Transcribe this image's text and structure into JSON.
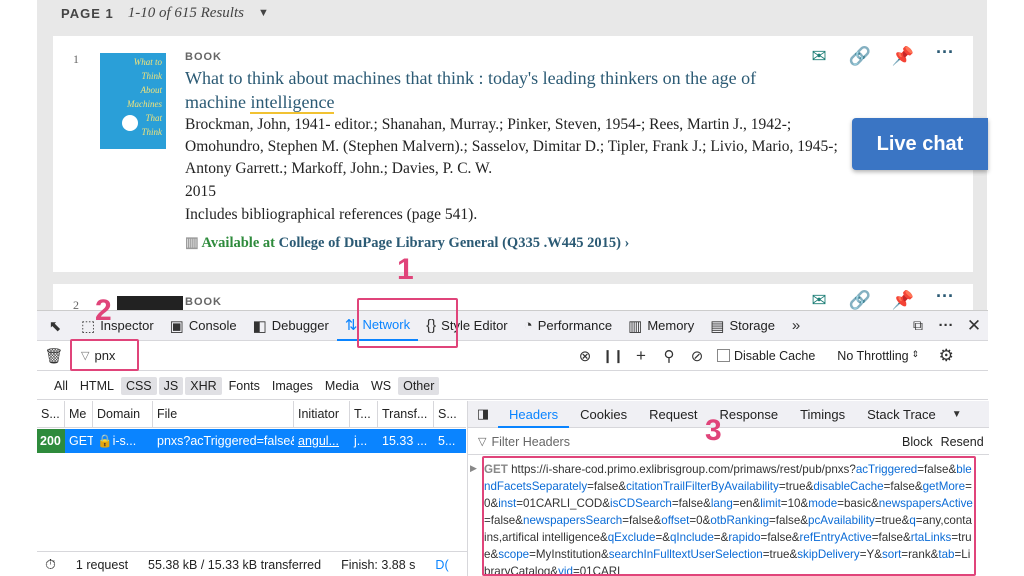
{
  "results": {
    "page_label": "PAGE 1",
    "count_label": "1-10 of 615 Results",
    "items": [
      {
        "number": "1",
        "type": "BOOK",
        "title_main": "What to think about machines that think : today's leading thinkers on the age of machine ",
        "title_highlight": "intelligence",
        "authors": "Brockman, John, 1941- editor.; Shanahan, Murray.; Pinker, Steven, 1954-; Rees, Martin J., 1942-; Omohundro, Stephen M. (Stephen Malvern).; Sasselov, Dimitar D.; Tipler, Frank J.; Livio, Mario, 1945-; Antony Garrett.; Markoff, John.; Davies, P. C. W.",
        "year": "2015",
        "note": "Includes bibliographical references (page 541).",
        "avail_label": "Available at",
        "avail_location": "College of DuPage Library  General (Q335 .W445 2015)",
        "cover_text": [
          "What to",
          "Think",
          "About",
          "Machines",
          "That",
          "Think"
        ]
      },
      {
        "number": "2",
        "type": "BOOK"
      }
    ]
  },
  "live_chat": "Live chat",
  "devtools": {
    "tabs": [
      {
        "icon": "inspector-icon",
        "glyph": "⬚",
        "label": "Inspector"
      },
      {
        "icon": "console-icon",
        "glyph": "▣",
        "label": "Console"
      },
      {
        "icon": "debugger-icon",
        "glyph": "◧",
        "label": "Debugger"
      },
      {
        "icon": "network-icon",
        "glyph": "⇅",
        "label": "Network"
      },
      {
        "icon": "style-editor-icon",
        "glyph": "{}",
        "label": "Style Editor"
      },
      {
        "icon": "performance-icon",
        "glyph": "◔",
        "label": "Performance"
      },
      {
        "icon": "memory-icon",
        "glyph": "▥",
        "label": "Memory"
      },
      {
        "icon": "storage-icon",
        "glyph": "▤",
        "label": "Storage"
      }
    ],
    "filter_value": "pnx",
    "disable_cache": "Disable Cache",
    "throttling": "No Throttling",
    "type_filters": [
      "All",
      "HTML",
      "CSS",
      "JS",
      "XHR",
      "Fonts",
      "Images",
      "Media",
      "WS",
      "Other"
    ],
    "columns": [
      "S...",
      "Me",
      "Domain",
      "File",
      "Initiator",
      "T...",
      "Transf...",
      "S..."
    ],
    "request": {
      "status": "200",
      "method": "GET",
      "domain": "i-s...",
      "file": "pnxs?acTriggered=false&",
      "initiator": "angul...",
      "type": "j...",
      "transferred": "15.33 ...",
      "size": "5..."
    },
    "status": {
      "requests": "1 request",
      "sizes": "55.38 kB / 15.33 kB transferred",
      "finish": "Finish: 3.88 s",
      "extra": "D("
    },
    "detail_tabs": [
      "Headers",
      "Cookies",
      "Request",
      "Response",
      "Timings",
      "Stack Trace"
    ],
    "filter_headers": "Filter Headers",
    "block": "Block",
    "resend": "Resend",
    "url_method": "GET",
    "url_parts": [
      {
        "t": "https://i-share-cod.primo.exlibrisgroup.com/primaws/rest/pub/pnxs?",
        "k": false
      },
      {
        "t": "acTriggered",
        "k": true
      },
      {
        "t": "=false&",
        "k": false
      },
      {
        "t": "blendFacetsSeparately",
        "k": true
      },
      {
        "t": "=false&",
        "k": false
      },
      {
        "t": "citationTrailFilterByAvailability",
        "k": true
      },
      {
        "t": "=true&",
        "k": false
      },
      {
        "t": "disableCache",
        "k": true
      },
      {
        "t": "=false&",
        "k": false
      },
      {
        "t": "getMore",
        "k": true
      },
      {
        "t": "=0&",
        "k": false
      },
      {
        "t": "inst",
        "k": true
      },
      {
        "t": "=01CARLI_COD&",
        "k": false
      },
      {
        "t": "isCDSearch",
        "k": true
      },
      {
        "t": "=false&",
        "k": false
      },
      {
        "t": "lang",
        "k": true
      },
      {
        "t": "=en&",
        "k": false
      },
      {
        "t": "limit",
        "k": true
      },
      {
        "t": "=10&",
        "k": false
      },
      {
        "t": "mode",
        "k": true
      },
      {
        "t": "=basic&",
        "k": false
      },
      {
        "t": "newspapersActive",
        "k": true
      },
      {
        "t": "=false&",
        "k": false
      },
      {
        "t": "newspapersSearch",
        "k": true
      },
      {
        "t": "=false&",
        "k": false
      },
      {
        "t": "offset",
        "k": true
      },
      {
        "t": "=0&",
        "k": false
      },
      {
        "t": "otbRanking",
        "k": true
      },
      {
        "t": "=false&",
        "k": false
      },
      {
        "t": "pcAvailability",
        "k": true
      },
      {
        "t": "=true&",
        "k": false
      },
      {
        "t": "q",
        "k": true
      },
      {
        "t": "=any,contains,artifical intelligence&",
        "k": false
      },
      {
        "t": "qExclude",
        "k": true
      },
      {
        "t": "=&",
        "k": false
      },
      {
        "t": "qInclude",
        "k": true
      },
      {
        "t": "=&",
        "k": false
      },
      {
        "t": "rapido",
        "k": true
      },
      {
        "t": "=false&",
        "k": false
      },
      {
        "t": "refEntryActive",
        "k": true
      },
      {
        "t": "=false&",
        "k": false
      },
      {
        "t": "rtaLinks",
        "k": true
      },
      {
        "t": "=true&",
        "k": false
      },
      {
        "t": "scope",
        "k": true
      },
      {
        "t": "=MyInstitution&",
        "k": false
      },
      {
        "t": "searchInFulltextUserSelection",
        "k": true
      },
      {
        "t": "=true&",
        "k": false
      },
      {
        "t": "skipDelivery",
        "k": true
      },
      {
        "t": "=Y&",
        "k": false
      },
      {
        "t": "sort",
        "k": true
      },
      {
        "t": "=rank&",
        "k": false
      },
      {
        "t": "tab",
        "k": true
      },
      {
        "t": "=LibraryCatalog&",
        "k": false
      },
      {
        "t": "vid",
        "k": true
      },
      {
        "t": "=01CARL",
        "k": false
      }
    ]
  },
  "annotations": [
    "1",
    "2",
    "3"
  ],
  "colors": {
    "accent": "#0a84ff",
    "annotation": "#e0447a",
    "chat": "#3a75c4",
    "link": "#2b5a74"
  }
}
